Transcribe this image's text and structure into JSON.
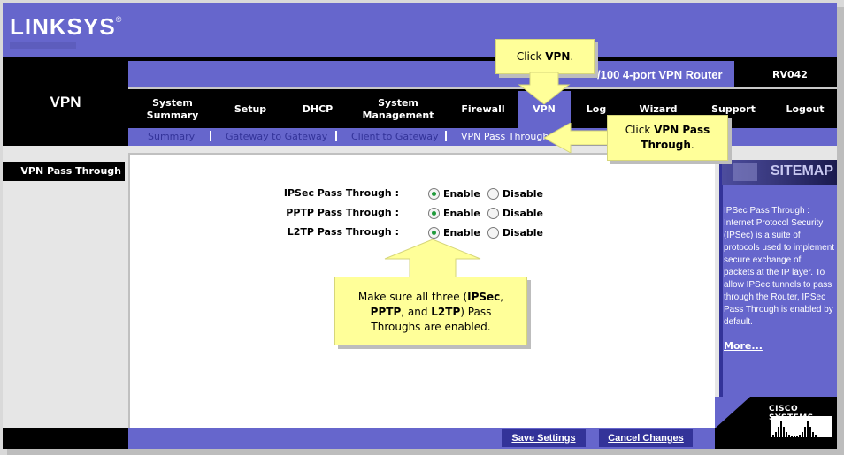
{
  "brand": {
    "logo": "LINKSYS",
    "registered": "®"
  },
  "section_title": "VPN",
  "model": {
    "title": "10/100 4-port VPN Router",
    "visible_title": "/100 4-port VPN Router",
    "code": "RV042"
  },
  "tabs": [
    {
      "label": "System Summary",
      "active": false
    },
    {
      "label": "Setup",
      "active": false
    },
    {
      "label": "DHCP",
      "active": false
    },
    {
      "label": "System Management",
      "active": false
    },
    {
      "label": "Firewall",
      "active": false
    },
    {
      "label": "VPN",
      "active": true
    },
    {
      "label": "Log",
      "active": false
    },
    {
      "label": "Wizard",
      "active": false
    },
    {
      "label": "Support",
      "active": false
    },
    {
      "label": "Logout",
      "active": false
    }
  ],
  "subnav": [
    {
      "label": "Summary",
      "active": false
    },
    {
      "label": "Gateway to Gateway",
      "active": false
    },
    {
      "label": "Client to Gateway",
      "active": false
    },
    {
      "label": "VPN Pass Through",
      "active": true
    }
  ],
  "left_label": "VPN Pass Through",
  "settings": [
    {
      "label": "IPSec Pass Through :",
      "value": "Enable",
      "options": [
        "Enable",
        "Disable"
      ]
    },
    {
      "label": "PPTP Pass Through :",
      "value": "Enable",
      "options": [
        "Enable",
        "Disable"
      ]
    },
    {
      "label": "L2TP Pass Through :",
      "value": "Enable",
      "options": [
        "Enable",
        "Disable"
      ]
    }
  ],
  "sidebar": {
    "heading": "SITEMAP",
    "text": "IPSec Pass Through :\nInternet Protocol Security\n(IPSec) is a suite of\nprotocols used to implement\nsecure exchange of\npackets at the IP layer. To\nallow IPSec tunnels to pass\nthrough the Router, IPSec\nPass Through is enabled by\ndefault.",
    "more": "More..."
  },
  "cisco": {
    "label": "CISCO SYSTEMS"
  },
  "footer": {
    "save": "Save Settings",
    "cancel": "Cancel Changes"
  },
  "callouts": {
    "vpn": {
      "prefix": "Click ",
      "bold": "VPN",
      "suffix": "."
    },
    "pass_through": {
      "prefix": "Click ",
      "bold": "VPN Pass Through",
      "suffix": "."
    },
    "enable": {
      "t1": "Make sure all three (",
      "b1": "IPSec",
      "t2": ",",
      "b2": "PPTP",
      "t3": ", and ",
      "b3": "L2TP",
      "t4": ") Pass Throughs are enabled."
    }
  },
  "colors": {
    "brand_purple": "#6666cc",
    "dark_blue": "#333399",
    "callout_yellow": "#ffff99",
    "radio_green": "#1f9a3a"
  }
}
